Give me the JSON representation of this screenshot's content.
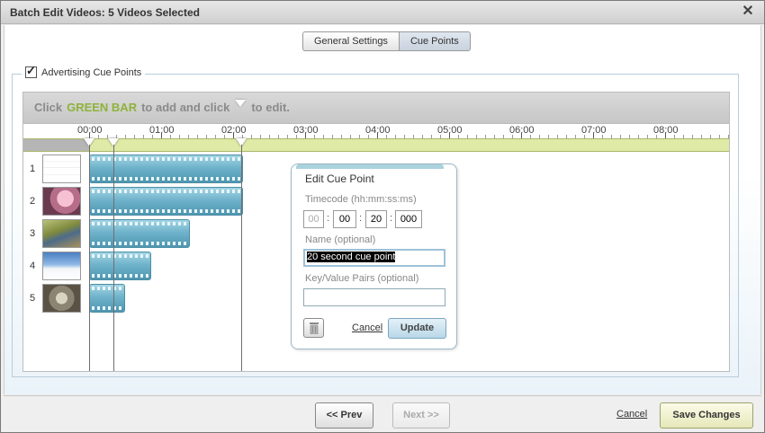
{
  "dialog": {
    "title": "Batch Edit Videos: 5 Videos Selected",
    "close_label": "✕"
  },
  "tabs": [
    {
      "label": "General Settings",
      "selected": false
    },
    {
      "label": "Cue Points",
      "selected": true
    }
  ],
  "section": {
    "checked": true,
    "check_mark": "✓",
    "legend": "Advertising Cue Points"
  },
  "instructions": {
    "part1": "Click",
    "green": "GREEN BAR",
    "part2": "to add and click",
    "part3": "to edit."
  },
  "timeline": {
    "ticks": [
      "00:00",
      "01:00",
      "02:00",
      "03:00",
      "04:00",
      "05:00",
      "06:00",
      "07:00",
      "08:00"
    ]
  },
  "videos": [
    {
      "number": "1"
    },
    {
      "number": "2"
    },
    {
      "number": "3"
    },
    {
      "number": "4"
    },
    {
      "number": "5"
    }
  ],
  "edit_cue_point": {
    "title": "Edit Cue Point",
    "timecode_label": "Timecode (hh:mm:ss:ms)",
    "hh": "00",
    "mm": "00",
    "ss": "20",
    "ms": "000",
    "separator": ":",
    "name_label": "Name (optional)",
    "name_value": "20 second cue point",
    "kv_label": "Key/Value Pairs (optional)",
    "kv_value": "",
    "cancel_label": "Cancel",
    "update_label": "Update"
  },
  "footer": {
    "prev_label": "<< Prev",
    "next_label": "Next >>",
    "cancel_label": "Cancel",
    "save_label": "Save Changes"
  },
  "colors": {
    "green_text": "#8fb23a",
    "green_bar": "#dfeaa6",
    "track_blue": "#6fb3cb"
  }
}
